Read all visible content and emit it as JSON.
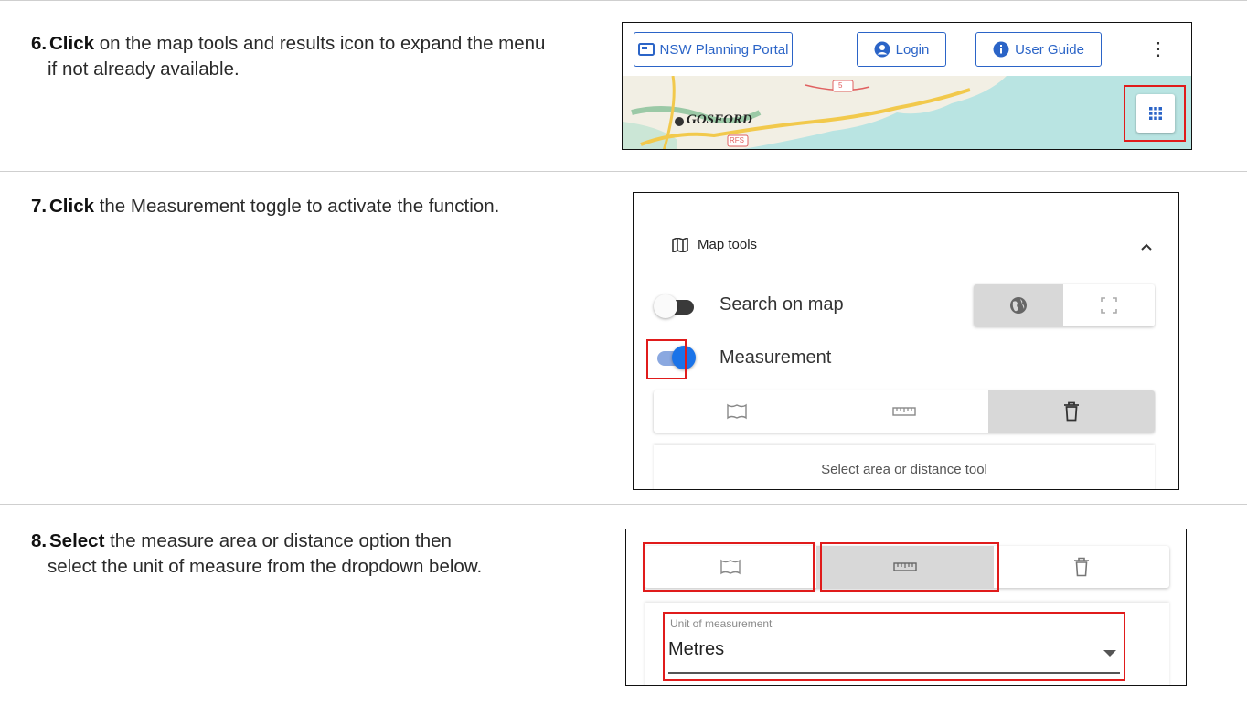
{
  "steps": [
    {
      "number": "6.",
      "verb": "Click",
      "text": " on the map tools and results icon to expand the menu if not already available."
    },
    {
      "number": "7.",
      "verb": "Click",
      "text": " the Measurement toggle to activate the function."
    },
    {
      "number": "8.",
      "verb": "Select",
      "text": " the measure area or distance option then select the unit of measure from the dropdown below."
    }
  ],
  "shot1": {
    "buttons": {
      "portal": "NSW Planning Portal",
      "login": "Login",
      "guide": "User Guide"
    },
    "map_labels": {
      "city": "GOSFORD",
      "badge": "RFS",
      "road": "5"
    },
    "colors": {
      "brand_blue": "#2b64c7",
      "sea": "#b9e4e2",
      "land": "#f2efe4",
      "road": "#f2c94c"
    }
  },
  "shot2": {
    "panel_title": "Map tools",
    "search_label": "Search on map",
    "measurement_label": "Measurement",
    "hint": "Select area or distance tool",
    "toggle_on": true,
    "colors": {
      "toggle_blue": "#1a73e8",
      "toggle_track": "#8aa8e0"
    }
  },
  "shot3": {
    "unit_label": "Unit of measurement",
    "unit_value": "Metres"
  },
  "highlight_color": "#e01b1b"
}
